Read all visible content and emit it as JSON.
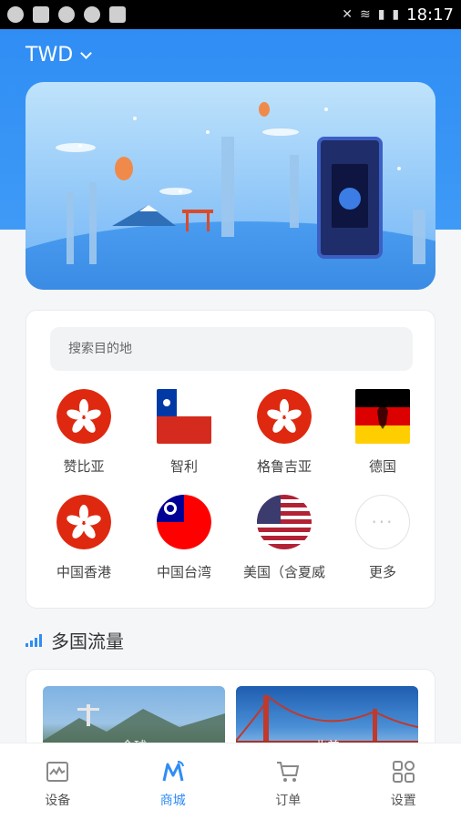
{
  "status_bar": {
    "time": "18:17"
  },
  "header": {
    "currency": "TWD"
  },
  "search": {
    "placeholder": "搜索目的地"
  },
  "destinations": [
    {
      "label": "赞比亚",
      "flag": "hong-kong-flag-icon"
    },
    {
      "label": "智利",
      "flag": "chile-flag-icon"
    },
    {
      "label": "格鲁吉亚",
      "flag": "hong-kong-flag-icon"
    },
    {
      "label": "德国",
      "flag": "germany-flag-icon"
    },
    {
      "label": "中国香港",
      "flag": "hong-kong-flag-icon"
    },
    {
      "label": "中国台湾",
      "flag": "taiwan-flag-icon"
    },
    {
      "label": "美国（含夏威",
      "flag": "usa-flag-icon"
    },
    {
      "label": "更多",
      "flag": "more-icon"
    }
  ],
  "multi_country": {
    "title": "多国流量",
    "cards": [
      {
        "label": "全球"
      },
      {
        "label": "北美"
      }
    ]
  },
  "tabbar": {
    "items": [
      {
        "label": "设备",
        "icon": "device-icon"
      },
      {
        "label": "商城",
        "icon": "mall-icon",
        "active": true
      },
      {
        "label": "订单",
        "icon": "cart-icon"
      },
      {
        "label": "设置",
        "icon": "settings-grid-icon"
      }
    ]
  },
  "colors": {
    "accent": "#2f8df4",
    "header_bg": "#3f9af6",
    "flag_red": "#de2910"
  }
}
